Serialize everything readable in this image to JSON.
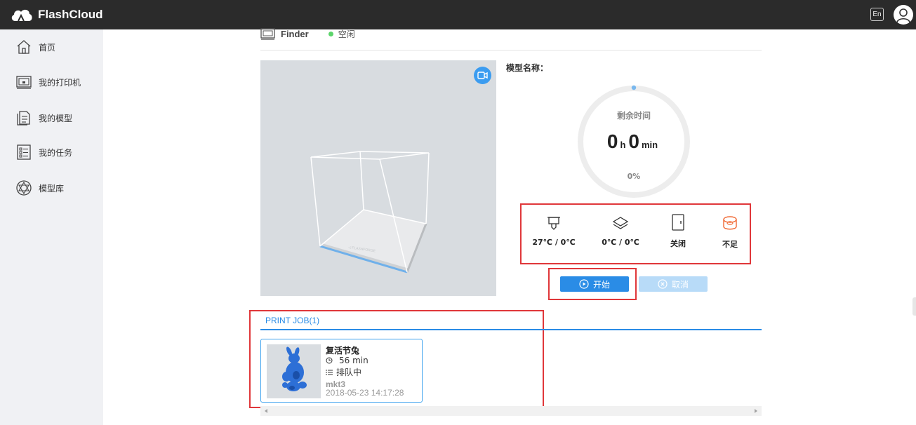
{
  "app": {
    "name": "FlashCloud",
    "lang_button": "En"
  },
  "sidebar": {
    "items": [
      {
        "label": "首页",
        "icon": "home-icon"
      },
      {
        "label": "我的打印机",
        "icon": "printer-icon"
      },
      {
        "label": "我的模型",
        "icon": "model-icon"
      },
      {
        "label": "我的任务",
        "icon": "task-list-icon"
      },
      {
        "label": "模型库",
        "icon": "model-library-icon"
      }
    ]
  },
  "printer": {
    "name": "Finder",
    "status": "空闲",
    "status_color": "#5bd46a"
  },
  "model": {
    "name_label": "模型名称："
  },
  "progress": {
    "remaining_label": "剩余时间",
    "hours": "0",
    "hours_unit": "h",
    "minutes": "0",
    "minutes_unit": "min",
    "percent_text": "0%",
    "fraction": 0
  },
  "status": {
    "nozzle_temp": "27℃ / 0℃",
    "bed_temp": "0℃ / 0℃",
    "door": "关闭",
    "filament": "不足"
  },
  "controls": {
    "start": "开始",
    "cancel": "取消"
  },
  "jobs": {
    "tab_label": "PRINT JOB(1)",
    "items": [
      {
        "title": "复活节兔",
        "duration": "56 min",
        "state": "排队中",
        "user": "mkt3",
        "date": "2018-05-23 14:17:28"
      }
    ]
  },
  "colors": {
    "accent": "#2a8ce6",
    "highlight_box": "#e0373a",
    "sidebar_bg": "#f0f1f4",
    "topbar_bg": "#2b2b2b"
  }
}
